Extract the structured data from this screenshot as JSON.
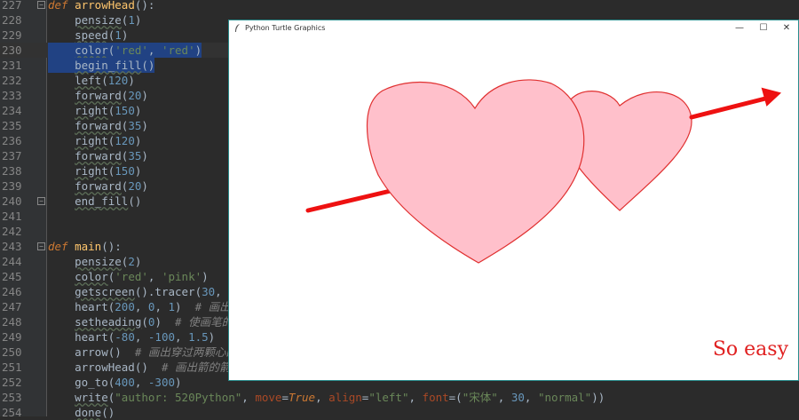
{
  "editor": {
    "lines": [
      {
        "n": "227",
        "parts": [
          [
            "kw",
            "def "
          ],
          [
            "fn",
            "arrowHead"
          ],
          [
            "p",
            "():"
          ]
        ]
      },
      {
        "n": "228",
        "parts": [
          [
            "p",
            "    "
          ],
          [
            "call",
            "pensize"
          ],
          [
            "p",
            "("
          ],
          [
            "num",
            "1"
          ],
          [
            "p",
            ")"
          ]
        ]
      },
      {
        "n": "229",
        "parts": [
          [
            "p",
            "    "
          ],
          [
            "call",
            "speed"
          ],
          [
            "p",
            "("
          ],
          [
            "num",
            "1"
          ],
          [
            "p",
            ")"
          ]
        ]
      },
      {
        "n": "230",
        "parts": [
          [
            "p",
            "    "
          ],
          [
            "call",
            "color"
          ],
          [
            "p",
            "("
          ],
          [
            "str",
            "'red'"
          ],
          [
            "p",
            ", "
          ],
          [
            "str",
            "'red'"
          ],
          [
            "p",
            ")"
          ]
        ]
      },
      {
        "n": "231",
        "parts": [
          [
            "p",
            "    "
          ],
          [
            "call",
            "begin_fill"
          ],
          [
            "p",
            "()"
          ]
        ]
      },
      {
        "n": "232",
        "parts": [
          [
            "p",
            "    "
          ],
          [
            "call",
            "left"
          ],
          [
            "p",
            "("
          ],
          [
            "num",
            "120"
          ],
          [
            "p",
            ")"
          ]
        ]
      },
      {
        "n": "233",
        "parts": [
          [
            "p",
            "    "
          ],
          [
            "call",
            "forward"
          ],
          [
            "p",
            "("
          ],
          [
            "num",
            "20"
          ],
          [
            "p",
            ")"
          ]
        ]
      },
      {
        "n": "234",
        "parts": [
          [
            "p",
            "    "
          ],
          [
            "call",
            "right"
          ],
          [
            "p",
            "("
          ],
          [
            "num",
            "150"
          ],
          [
            "p",
            ")"
          ]
        ]
      },
      {
        "n": "235",
        "parts": [
          [
            "p",
            "    "
          ],
          [
            "call",
            "forward"
          ],
          [
            "p",
            "("
          ],
          [
            "num",
            "35"
          ],
          [
            "p",
            ")"
          ]
        ]
      },
      {
        "n": "236",
        "parts": [
          [
            "p",
            "    "
          ],
          [
            "call",
            "right"
          ],
          [
            "p",
            "("
          ],
          [
            "num",
            "120"
          ],
          [
            "p",
            ")"
          ]
        ]
      },
      {
        "n": "237",
        "parts": [
          [
            "p",
            "    "
          ],
          [
            "call",
            "forward"
          ],
          [
            "p",
            "("
          ],
          [
            "num",
            "35"
          ],
          [
            "p",
            ")"
          ]
        ]
      },
      {
        "n": "238",
        "parts": [
          [
            "p",
            "    "
          ],
          [
            "call",
            "right"
          ],
          [
            "p",
            "("
          ],
          [
            "num",
            "150"
          ],
          [
            "p",
            ")"
          ]
        ]
      },
      {
        "n": "239",
        "parts": [
          [
            "p",
            "    "
          ],
          [
            "call",
            "forward"
          ],
          [
            "p",
            "("
          ],
          [
            "num",
            "20"
          ],
          [
            "p",
            ")"
          ]
        ]
      },
      {
        "n": "240",
        "parts": [
          [
            "p",
            "    "
          ],
          [
            "call",
            "end_fill"
          ],
          [
            "p",
            "()"
          ]
        ]
      },
      {
        "n": "241",
        "parts": []
      },
      {
        "n": "242",
        "parts": []
      },
      {
        "n": "243",
        "parts": [
          [
            "kw",
            "def "
          ],
          [
            "fn",
            "main"
          ],
          [
            "p",
            "():"
          ]
        ]
      },
      {
        "n": "244",
        "parts": [
          [
            "p",
            "    "
          ],
          [
            "call",
            "pensize"
          ],
          [
            "p",
            "("
          ],
          [
            "num",
            "2"
          ],
          [
            "p",
            ")"
          ]
        ]
      },
      {
        "n": "245",
        "parts": [
          [
            "p",
            "    "
          ],
          [
            "call",
            "color"
          ],
          [
            "p",
            "("
          ],
          [
            "str",
            "'red'"
          ],
          [
            "p",
            ", "
          ],
          [
            "str",
            "'pink'"
          ],
          [
            "p",
            ")"
          ]
        ]
      },
      {
        "n": "246",
        "parts": [
          [
            "p",
            "    "
          ],
          [
            "call",
            "getscreen"
          ],
          [
            "p",
            "().tracer("
          ],
          [
            "num",
            "30"
          ],
          [
            "p",
            ", "
          ],
          [
            "num",
            "0"
          ],
          [
            "p",
            ")"
          ]
        ]
      },
      {
        "n": "247",
        "parts": [
          [
            "p",
            "    heart("
          ],
          [
            "num",
            "200"
          ],
          [
            "p",
            ", "
          ],
          [
            "num",
            "0"
          ],
          [
            "p",
            ", "
          ],
          [
            "num",
            "1"
          ],
          [
            "p",
            ")  "
          ],
          [
            "cm",
            "# 画出第"
          ]
        ]
      },
      {
        "n": "248",
        "parts": [
          [
            "p",
            "    "
          ],
          [
            "call",
            "setheading"
          ],
          [
            "p",
            "("
          ],
          [
            "num",
            "0"
          ],
          [
            "p",
            ")  "
          ],
          [
            "cm",
            "# 使画笔的方"
          ]
        ]
      },
      {
        "n": "249",
        "parts": [
          [
            "p",
            "    heart("
          ],
          [
            "num",
            "-80"
          ],
          [
            "p",
            ", "
          ],
          [
            "num",
            "-100"
          ],
          [
            "p",
            ", "
          ],
          [
            "num",
            "1.5"
          ],
          [
            "p",
            ")  "
          ],
          [
            "cm",
            "#"
          ]
        ]
      },
      {
        "n": "250",
        "parts": [
          [
            "p",
            "    arrow()  "
          ],
          [
            "cm",
            "# 画出穿过两颗心的"
          ]
        ]
      },
      {
        "n": "251",
        "parts": [
          [
            "p",
            "    arrowHead()  "
          ],
          [
            "cm",
            "# 画出箭的箭头"
          ]
        ]
      },
      {
        "n": "252",
        "parts": [
          [
            "p",
            "    go_to("
          ],
          [
            "num",
            "400"
          ],
          [
            "p",
            ", "
          ],
          [
            "num",
            "-300"
          ],
          [
            "p",
            ")"
          ]
        ]
      },
      {
        "n": "253",
        "parts": [
          [
            "p",
            "    "
          ],
          [
            "call",
            "write"
          ],
          [
            "p",
            "("
          ],
          [
            "str",
            "\"author: 520Python\""
          ],
          [
            "p",
            ", "
          ],
          [
            "kwarg",
            "move"
          ],
          [
            "p",
            "="
          ],
          [
            "kw",
            "True"
          ],
          [
            "p",
            ", "
          ],
          [
            "kwarg",
            "align"
          ],
          [
            "p",
            "="
          ],
          [
            "str",
            "\"left\""
          ],
          [
            "p",
            ", "
          ],
          [
            "kwarg",
            "font"
          ],
          [
            "p",
            "=("
          ],
          [
            "str",
            "\"宋体\""
          ],
          [
            "p",
            ", "
          ],
          [
            "num",
            "30"
          ],
          [
            "p",
            ", "
          ],
          [
            "str",
            "\"normal\""
          ],
          [
            "p",
            "))"
          ]
        ]
      },
      {
        "n": "254",
        "parts": [
          [
            "p",
            "    "
          ],
          [
            "call",
            "done"
          ],
          [
            "p",
            "()"
          ]
        ]
      }
    ]
  },
  "turtle_window": {
    "title": "Python Turtle Graphics",
    "minimize": "—",
    "maximize": "☐",
    "close": "✕",
    "canvas_text": "So easy",
    "colors": {
      "heart_fill": "#ffc0cb",
      "heart_stroke": "#e03030",
      "arrow": "#ee1111"
    }
  }
}
